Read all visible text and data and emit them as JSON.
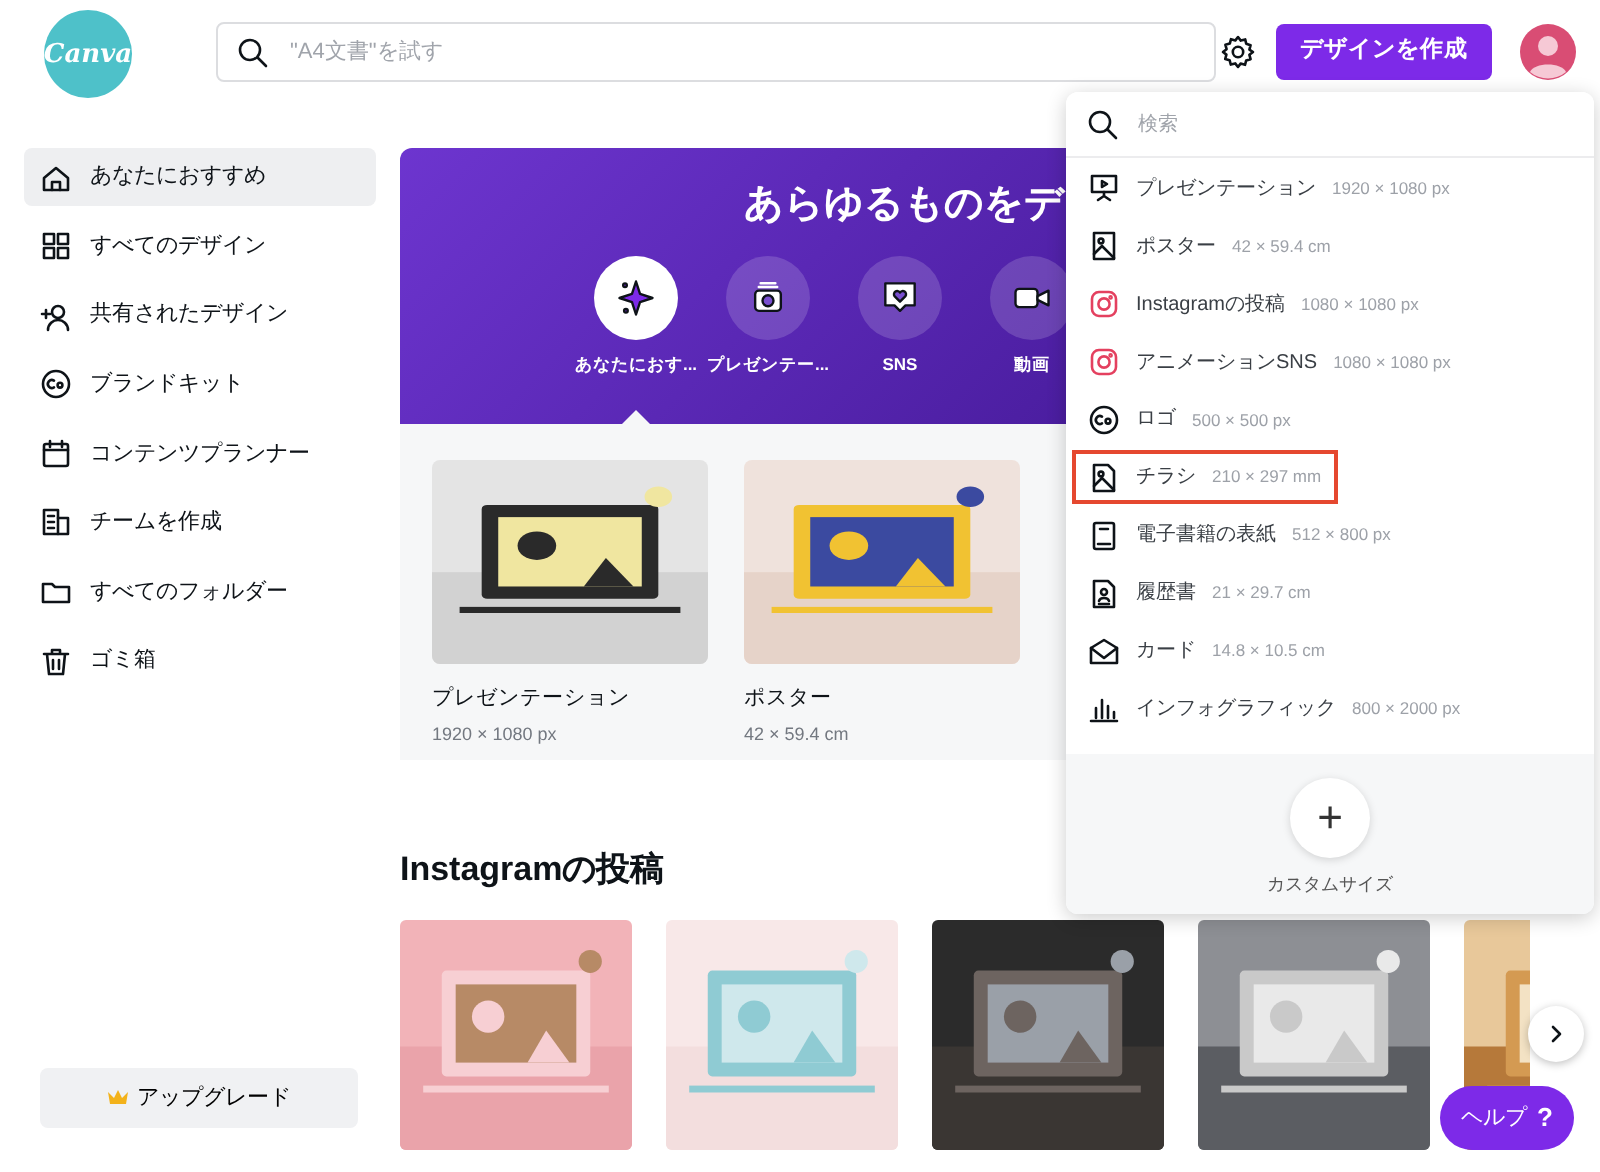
{
  "header": {
    "logo": "Canva",
    "search": {
      "placeholder": "\"A4文書\"を試す"
    },
    "create_button": "デザインを作成"
  },
  "sidebar": {
    "items": [
      {
        "label": "あなたにおすすめ",
        "selected": true
      },
      {
        "label": "すべてのデザイン",
        "selected": false
      },
      {
        "label": "共有されたデザイン",
        "selected": false
      },
      {
        "label": "ブランドキット",
        "selected": false
      },
      {
        "label": "コンテンツプランナー",
        "selected": false
      },
      {
        "label": "チームを作成",
        "selected": false
      },
      {
        "label": "すべてのフォルダー",
        "selected": false
      },
      {
        "label": "ゴミ箱",
        "selected": false
      }
    ],
    "upgrade_button": "アップグレード"
  },
  "banner": {
    "title": "あらゆるものをデ",
    "categories": [
      {
        "label": "あなたにおす...",
        "selected": true
      },
      {
        "label": "プレゼンテー...",
        "selected": false
      },
      {
        "label": "SNS",
        "selected": false
      },
      {
        "label": "動画",
        "selected": false
      }
    ]
  },
  "suggestions": [
    {
      "title": "プレゼンテーション",
      "size": "1920 × 1080 px",
      "kind": "picture"
    },
    {
      "title": "ポスター",
      "size": "42 × 59.4 cm",
      "kind": "picture"
    }
  ],
  "instagram": {
    "heading": "Instagramの投稿"
  },
  "help_button": {
    "label": "ヘルプ",
    "icon": "?"
  },
  "dropdown": {
    "search": {
      "placeholder": "検索"
    },
    "items": [
      {
        "label": "プレゼンテーション",
        "size": "1920 × 1080 px",
        "selected": false
      },
      {
        "label": "ポスター",
        "size": "42 × 59.4 cm",
        "selected": false
      },
      {
        "label": "Instagramの投稿",
        "size": "1080 × 1080 px",
        "selected": false
      },
      {
        "label": "アニメーションSNS",
        "size": "1080 × 1080 px",
        "selected": false
      },
      {
        "label": "ロゴ",
        "size": "500 × 500 px",
        "selected": false
      },
      {
        "label": "チラシ",
        "size": "210 × 297 mm",
        "selected": true
      },
      {
        "label": "電子書籍の表紙",
        "size": "512 × 800 px",
        "selected": false
      },
      {
        "label": "履歴書",
        "size": "21 × 29.7 cm",
        "selected": false
      },
      {
        "label": "カード",
        "size": "14.8 × 10.5 cm",
        "selected": false
      },
      {
        "label": "インフォグラフィック",
        "size": "800 × 2000 px",
        "selected": false
      }
    ],
    "custom_size": {
      "icon": "+",
      "label": "カスタムサイズ"
    }
  }
}
